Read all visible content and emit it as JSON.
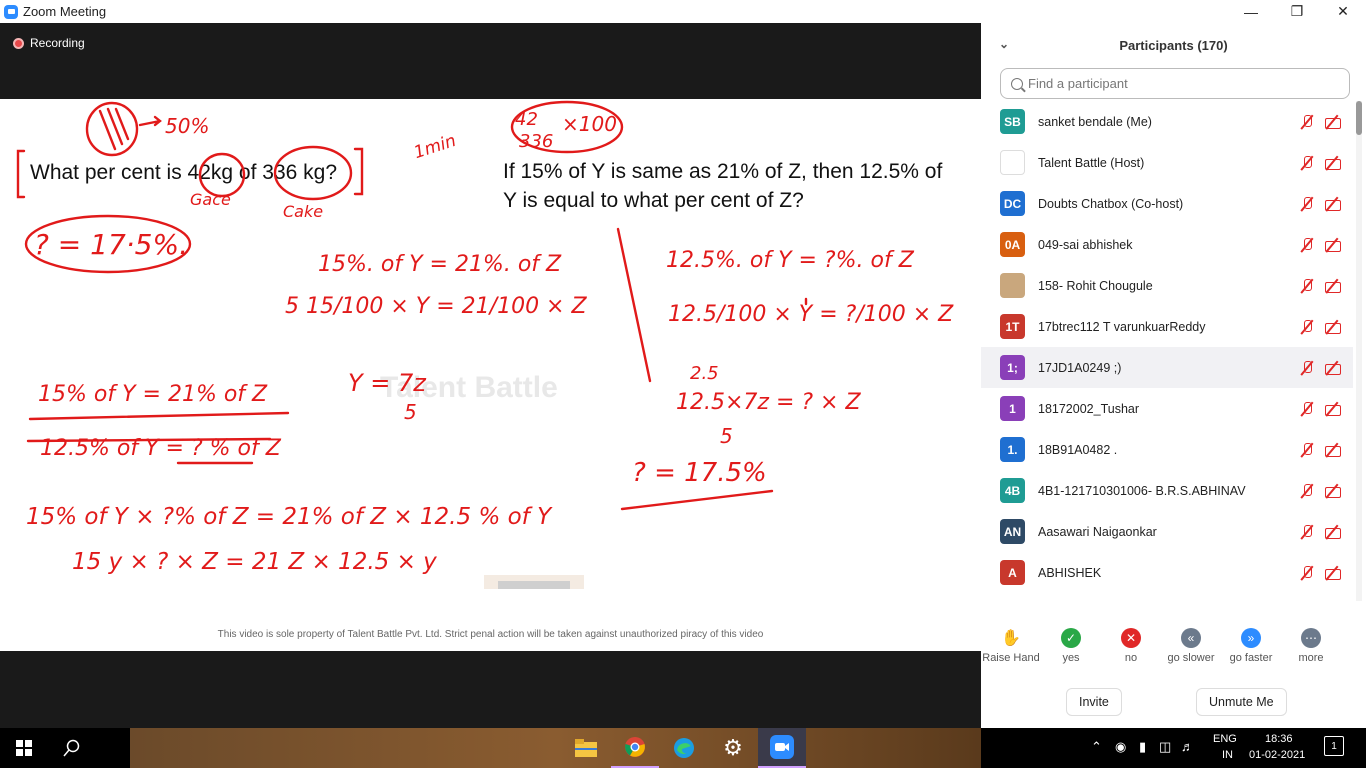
{
  "window": {
    "title": "Zoom Meeting"
  },
  "meeting": {
    "recording_label": "Recording"
  },
  "whiteboard": {
    "question1": "What per cent is 42kg of 336 kg?",
    "question2": "If 15% of Y is same as 21% of Z, then 12.5% of Y is equal to what per cent of Z?",
    "watermark": "Talent Battle",
    "footer": "This video is sole property of Talent Battle Pvt. Ltd. Strict penal action will be taken against unauthorized piracy of this video"
  },
  "participants": {
    "header": "Participants (170)",
    "search_placeholder": "Find a participant",
    "list": [
      {
        "initials": "SB",
        "name": "sanket bendale (Me)",
        "color": "#1f9c94"
      },
      {
        "initials": "",
        "name": "Talent Battle (Host)",
        "color": "#ffffff"
      },
      {
        "initials": "DC",
        "name": "Doubts Chatbox (Co-host)",
        "color": "#1f6fd1"
      },
      {
        "initials": "0A",
        "name": "049-sai abhishek",
        "color": "#d85f10"
      },
      {
        "initials": "",
        "name": "158- Rohit Chougule",
        "color": "#c9a77d"
      },
      {
        "initials": "1T",
        "name": "17btrec112 T varunkuarReddy",
        "color": "#c8382c"
      },
      {
        "initials": "1;",
        "name": "17JD1A0249 ;)",
        "color": "#8a3fb8"
      },
      {
        "initials": "1",
        "name": "18172002_Tushar",
        "color": "#8a3fb8"
      },
      {
        "initials": "1.",
        "name": "18B91A0482 .",
        "color": "#1f6fd1"
      },
      {
        "initials": "4B",
        "name": "4B1-121710301006- B.R.S.ABHINAV",
        "color": "#1f9c94"
      },
      {
        "initials": "AN",
        "name": "Aasawari Naigaonkar",
        "color": "#2e4a66"
      },
      {
        "initials": "A",
        "name": "ABHISHEK",
        "color": "#c8382c"
      }
    ]
  },
  "reactions": [
    {
      "label": "Raise Hand",
      "icon": "raise-hand-icon",
      "color": "#2d8cff",
      "glyph": "✋"
    },
    {
      "label": "yes",
      "icon": "check-icon",
      "color": "#2aa847",
      "glyph": "✓"
    },
    {
      "label": "no",
      "icon": "cross-icon",
      "color": "#e02828",
      "glyph": "✕"
    },
    {
      "label": "go slower",
      "icon": "rewind-icon",
      "color": "#6c7a8c",
      "glyph": "«"
    },
    {
      "label": "go faster",
      "icon": "fast-forward-icon",
      "color": "#2d8cff",
      "glyph": "»"
    },
    {
      "label": "more",
      "icon": "more-icon",
      "color": "#6c7a8c",
      "glyph": "⋯"
    }
  ],
  "buttons": {
    "invite": "Invite",
    "unmute": "Unmute Me"
  },
  "taskbar": {
    "lang": "ENG",
    "region": "IN",
    "time": "18:36",
    "date": "01-02-2021",
    "notifications": "1"
  }
}
